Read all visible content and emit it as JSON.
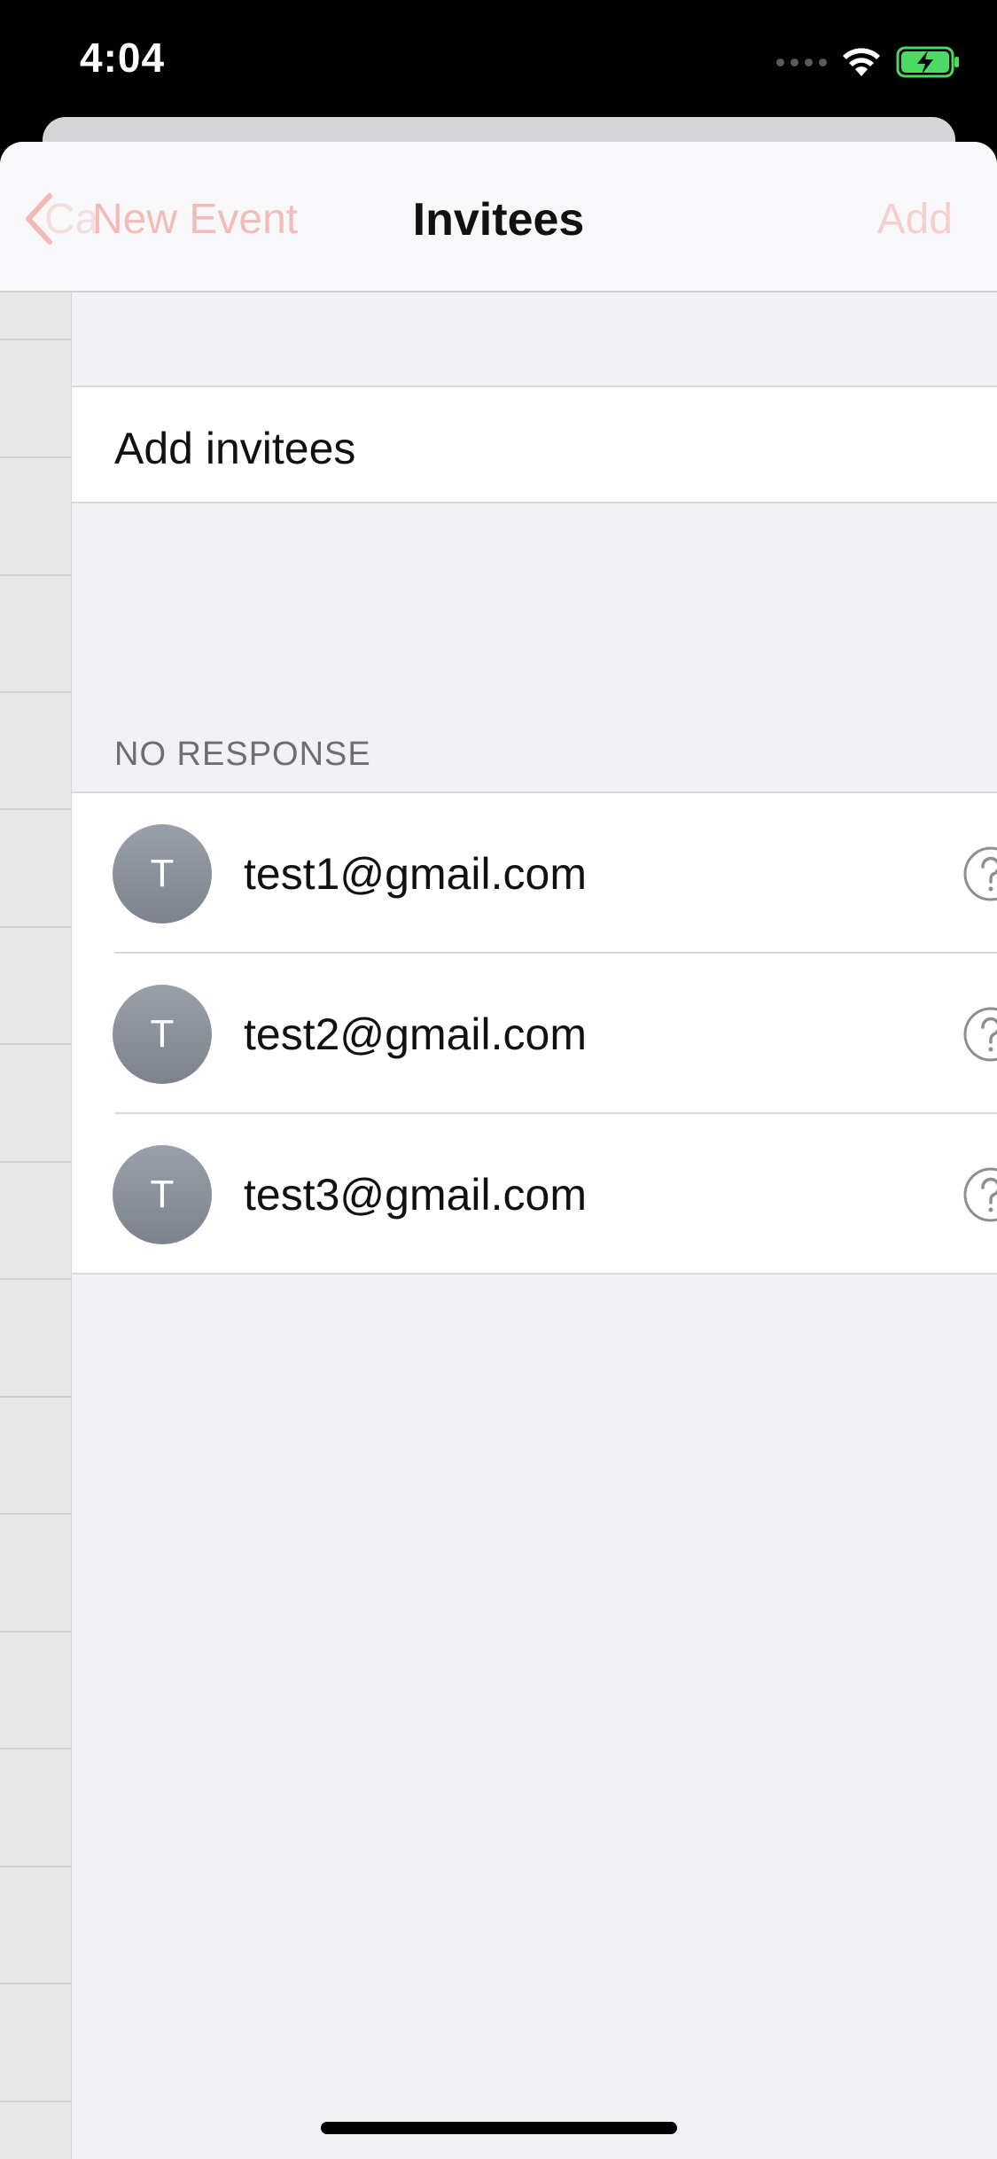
{
  "status_bar": {
    "time": "4:04"
  },
  "nav": {
    "back_ghost": "Ca",
    "back_label": "New Event",
    "title": "Invitees",
    "add_label": "Add"
  },
  "add_invitees": {
    "label": "Add invitees"
  },
  "section": {
    "header": "NO RESPONSE"
  },
  "invitees": [
    {
      "initial": "T",
      "email": "test1@gmail.com",
      "status_icon": "question-circle-icon"
    },
    {
      "initial": "T",
      "email": "test2@gmail.com",
      "status_icon": "question-circle-icon"
    },
    {
      "initial": "T",
      "email": "test3@gmail.com",
      "status_icon": "question-circle-icon"
    }
  ],
  "colors": {
    "accent_faded": "#f0a8a2",
    "battery_green": "#4cd964",
    "avatar_gray": "#8a9099"
  }
}
